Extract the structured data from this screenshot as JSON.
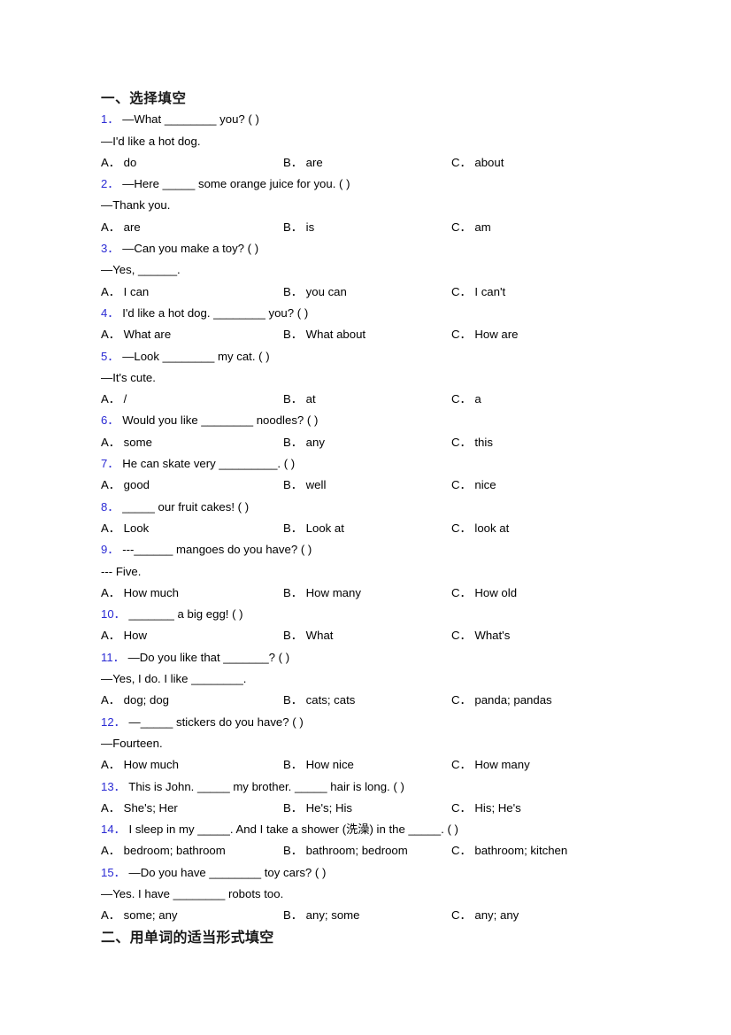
{
  "document": {
    "sections": [
      {
        "heading": "一、选择填空",
        "questions": [
          {
            "number": "1．",
            "stem": "—What ________ you? (  )",
            "followup": "—I'd like a hot dog.",
            "options": [
              {
                "label": "A．",
                "text": "do"
              },
              {
                "label": "B．",
                "text": "are"
              },
              {
                "label": "C．",
                "text": "about"
              }
            ]
          },
          {
            "number": "2．",
            "stem": "—Here _____ some orange juice for you. (  )",
            "followup": "—Thank you.",
            "options": [
              {
                "label": "A．",
                "text": "are"
              },
              {
                "label": "B．",
                "text": "is"
              },
              {
                "label": "C．",
                "text": "am"
              }
            ]
          },
          {
            "number": "3．",
            "stem": "—Can you make a toy? (  )",
            "followup": "—Yes, ______.",
            "options": [
              {
                "label": "A．",
                "text": "I can"
              },
              {
                "label": "B．",
                "text": "you can"
              },
              {
                "label": "C．",
                "text": "I can't"
              }
            ]
          },
          {
            "number": "4．",
            "stem": "I'd like a hot dog. ________ you? (  )",
            "followup": "",
            "options": [
              {
                "label": "A．",
                "text": "What are"
              },
              {
                "label": "B．",
                "text": "What about"
              },
              {
                "label": "C．",
                "text": "How are"
              }
            ]
          },
          {
            "number": "5．",
            "stem": "—Look ________ my cat. (   )",
            "followup": "—It's cute.",
            "options": [
              {
                "label": "A．",
                "text": "/"
              },
              {
                "label": "B．",
                "text": "at"
              },
              {
                "label": "C．",
                "text": "a"
              }
            ]
          },
          {
            "number": "6．",
            "stem": "Would you like ________ noodles? (  )",
            "followup": "",
            "options": [
              {
                "label": "A．",
                "text": "some"
              },
              {
                "label": "B．",
                "text": "any"
              },
              {
                "label": "C．",
                "text": "this"
              }
            ]
          },
          {
            "number": "7．",
            "stem": "He can skate very _________. (   )",
            "followup": "",
            "options": [
              {
                "label": "A．",
                "text": "good"
              },
              {
                "label": "B．",
                "text": "well"
              },
              {
                "label": "C．",
                "text": "nice"
              }
            ]
          },
          {
            "number": "8．",
            "stem": "_____ our fruit cakes! (  )",
            "followup": "",
            "options": [
              {
                "label": "A．",
                "text": "Look"
              },
              {
                "label": "B．",
                "text": "Look at"
              },
              {
                "label": "C．",
                "text": "look at"
              }
            ]
          },
          {
            "number": "9．",
            "stem": "---______ mangoes do you have? (  )",
            "followup": "--- Five.",
            "options": [
              {
                "label": "A．",
                "text": "How much"
              },
              {
                "label": "B．",
                "text": "How many"
              },
              {
                "label": "C．",
                "text": "How old"
              }
            ]
          },
          {
            "number": "10．",
            "stem": "_______ a big egg! (  )",
            "followup": "",
            "options": [
              {
                "label": "A．",
                "text": "How"
              },
              {
                "label": "B．",
                "text": "What"
              },
              {
                "label": "C．",
                "text": "What's"
              }
            ]
          },
          {
            "number": "11．",
            "stem": "—Do you like that _______? (  )",
            "followup": "—Yes, I do. I like ________.",
            "options": [
              {
                "label": "A．",
                "text": "dog; dog"
              },
              {
                "label": "B．",
                "text": "cats; cats"
              },
              {
                "label": "C．",
                "text": "panda; pandas"
              }
            ]
          },
          {
            "number": "12．",
            "stem": "—_____ stickers do you have? (  )",
            "followup": "—Fourteen.",
            "options": [
              {
                "label": "A．",
                "text": "How much"
              },
              {
                "label": "B．",
                "text": "How nice"
              },
              {
                "label": "C．",
                "text": "How many"
              }
            ]
          },
          {
            "number": "13．",
            "stem": "This is John. _____ my brother. _____ hair is long. (  )",
            "followup": "",
            "options": [
              {
                "label": "A．",
                "text": "She's; Her"
              },
              {
                "label": "B．",
                "text": "He's; His"
              },
              {
                "label": "C．",
                "text": "His; He's"
              }
            ]
          },
          {
            "number": "14．",
            "stem": "I sleep in my _____. And I take a shower (洗澡) in the _____. (  )",
            "followup": "",
            "options": [
              {
                "label": "A．",
                "text": "bedroom; bathroom"
              },
              {
                "label": "B．",
                "text": "bathroom; bedroom"
              },
              {
                "label": "C．",
                "text": "bathroom; kitchen"
              }
            ]
          },
          {
            "number": "15．",
            "stem": "—Do you have ________ toy cars? (  )",
            "followup": "—Yes. I have ________ robots too.",
            "options": [
              {
                "label": "A．",
                "text": "some; any"
              },
              {
                "label": "B．",
                "text": "any; some"
              },
              {
                "label": "C．",
                "text": "any; any"
              }
            ]
          }
        ]
      },
      {
        "heading": "二、用单词的适当形式填空",
        "questions": []
      }
    ]
  }
}
